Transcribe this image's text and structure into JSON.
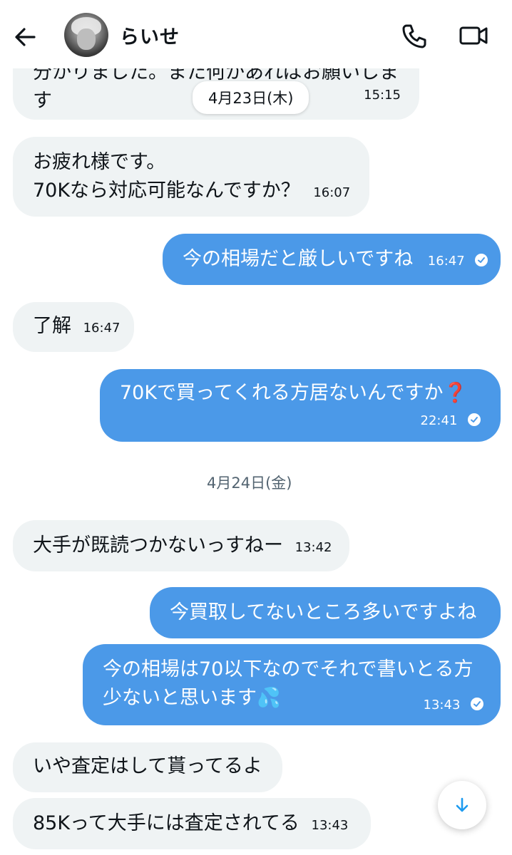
{
  "header": {
    "name": "らいせ",
    "back_icon": "arrow-left-icon",
    "call_icon": "phone-icon",
    "video_icon": "video-camera-icon"
  },
  "date_dividers": {
    "d1": "4月23日(木)",
    "d2": "4月24日(金)"
  },
  "messages": [
    {
      "side": "left",
      "line1": "分かりました。また何かあればお願いしま",
      "line2": "す",
      "time": "15:15"
    },
    {
      "side": "left",
      "line1": "お疲れ様です。",
      "line2": "70Kなら対応可能なんですか？",
      "time": "16:07"
    },
    {
      "side": "right",
      "text": "今の相場だと厳しいですね",
      "time": "16:47",
      "read": true
    },
    {
      "side": "left",
      "text": "了解",
      "time": "16:47"
    },
    {
      "side": "right",
      "text": "70Kで買ってくれる方居ないんですか",
      "emoji": "❓",
      "time": "22:41",
      "read": true
    },
    {
      "side": "left",
      "text": "大手が既読つかないっすねー",
      "time": "13:42"
    },
    {
      "side": "right",
      "text": "今買取してないところ多いですよね"
    },
    {
      "side": "right",
      "line1": "今の相場は70以下なのでそれで書いとる方",
      "line2": "少ないと思います",
      "emoji": "💦",
      "time": "13:43",
      "read": true
    },
    {
      "side": "left",
      "text": "いや査定はして貰ってるよ"
    },
    {
      "side": "left",
      "text": "85Kって大手には査定されてる",
      "time": "13:43"
    }
  ],
  "colors": {
    "outgoing_bubble": "#4b99e8",
    "incoming_bubble": "#eff3f4",
    "accent": "#1d9bf0"
  },
  "scroll_button_icon": "arrow-down-icon"
}
